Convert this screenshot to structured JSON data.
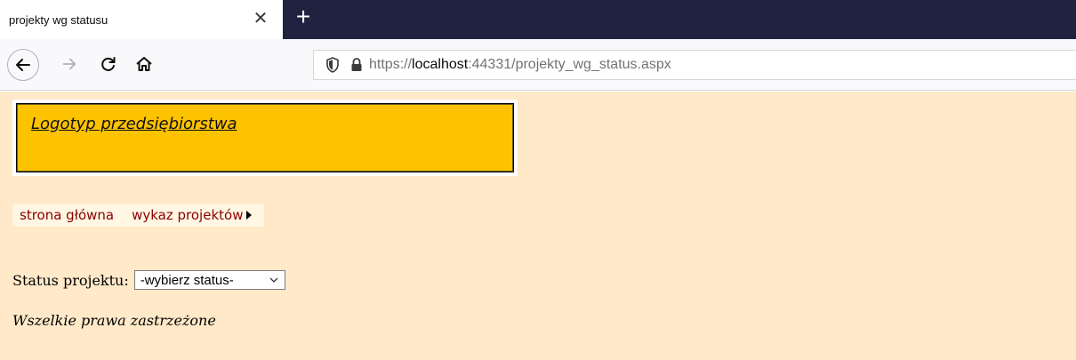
{
  "browser": {
    "tab": {
      "title": "projekty wg statusu",
      "close_glyph": "✕"
    },
    "new_tab_glyph": "+",
    "nav": {
      "back_icon": "arrow-left-icon",
      "forward_icon": "arrow-right-icon",
      "reload_icon": "reload-icon",
      "home_icon": "home-icon"
    },
    "url": {
      "scheme": "https://",
      "host": "localhost",
      "rest": ":44331/projekty_wg_status.aspx",
      "shield_icon": "shield-icon",
      "lock_icon": "lock-icon"
    }
  },
  "page": {
    "logo_text": "Logotyp przedsiębiorstwa",
    "menu": {
      "items": [
        {
          "label": "strona główna"
        },
        {
          "label": "wykaz projektów"
        }
      ]
    },
    "status": {
      "label": "Status projektu:",
      "selected": "-wybierz status-"
    },
    "footer": "Wszelkie prawa zastrzeżone"
  },
  "colors": {
    "tabstrip_bg": "#202340",
    "page_bg": "#ffe9c9",
    "logo_bg": "#fdc200",
    "menu_link": "#8b0000"
  }
}
